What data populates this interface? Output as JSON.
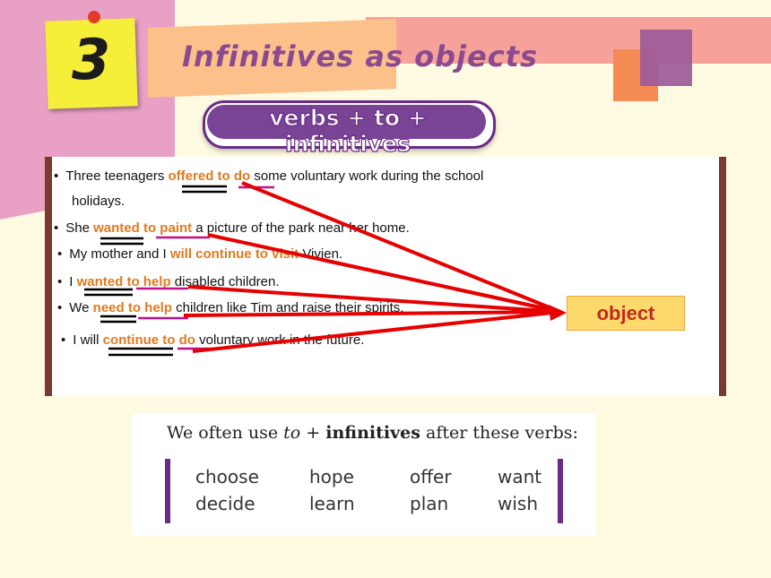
{
  "slide_number": "3",
  "title": "Infinitives as objects",
  "subtitle": "verbs + to + infinitives",
  "sentences": {
    "s1": {
      "pre": "Three teenagers ",
      "hl": "offered to do",
      "post": " some voluntary work during the school",
      "cont": "holidays."
    },
    "s2": {
      "pre": "She ",
      "hl": "wanted to paint",
      "post": " a picture of the park near her home."
    },
    "s3": {
      "pre": "My mother and I ",
      "hl": "will continue to visit",
      "post": " Vivien."
    },
    "s4": {
      "pre": "I ",
      "hl": "wanted to help",
      "post": " disabled children."
    },
    "s5": {
      "pre": "We ",
      "hl": "need to help",
      "post": " children like Tim and raise their spirits."
    },
    "s6": {
      "pre": "I will ",
      "hl": "continue to do",
      "post": " voluntary work in the future."
    }
  },
  "object_label": "object",
  "table": {
    "heading_pre": "We often use ",
    "heading_to": "to",
    "heading_plus": " + ",
    "heading_bold": "infinitives",
    "heading_post": " after these verbs:",
    "row1": [
      "choose",
      "hope",
      "offer",
      "want"
    ],
    "row2": [
      "decide",
      "learn",
      "plan",
      "wish"
    ]
  },
  "colors": {
    "accent": "#e17a1e",
    "arrow": "#e60000",
    "purple": "#6a2c86"
  }
}
